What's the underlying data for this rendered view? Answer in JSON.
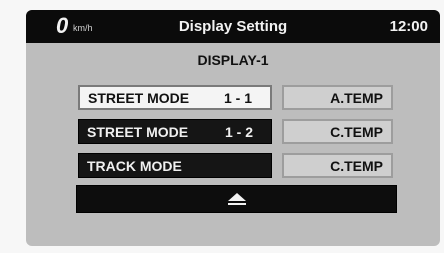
{
  "header": {
    "speed_value": "0",
    "speed_unit": "km/h",
    "title": "Display Setting",
    "clock": "12:00"
  },
  "display": {
    "subtitle": "DISPLAY-1",
    "rows": [
      {
        "mode_label": "STREET MODE",
        "mode_number": "1 - 1",
        "temp_label": "A.TEMP",
        "selected": true
      },
      {
        "mode_label": "STREET MODE",
        "mode_number": "1 - 2",
        "temp_label": "C.TEMP",
        "selected": false
      },
      {
        "mode_label": "TRACK MODE",
        "mode_number": "",
        "temp_label": "C.TEMP",
        "selected": false
      }
    ]
  },
  "controls": {
    "eject_icon": "eject-icon"
  },
  "colors": {
    "screen_bg": "#bdbdbd",
    "header_bg": "#0b0b0b",
    "selected_button": "#f4f4f4",
    "unselected_button": "#151515"
  }
}
